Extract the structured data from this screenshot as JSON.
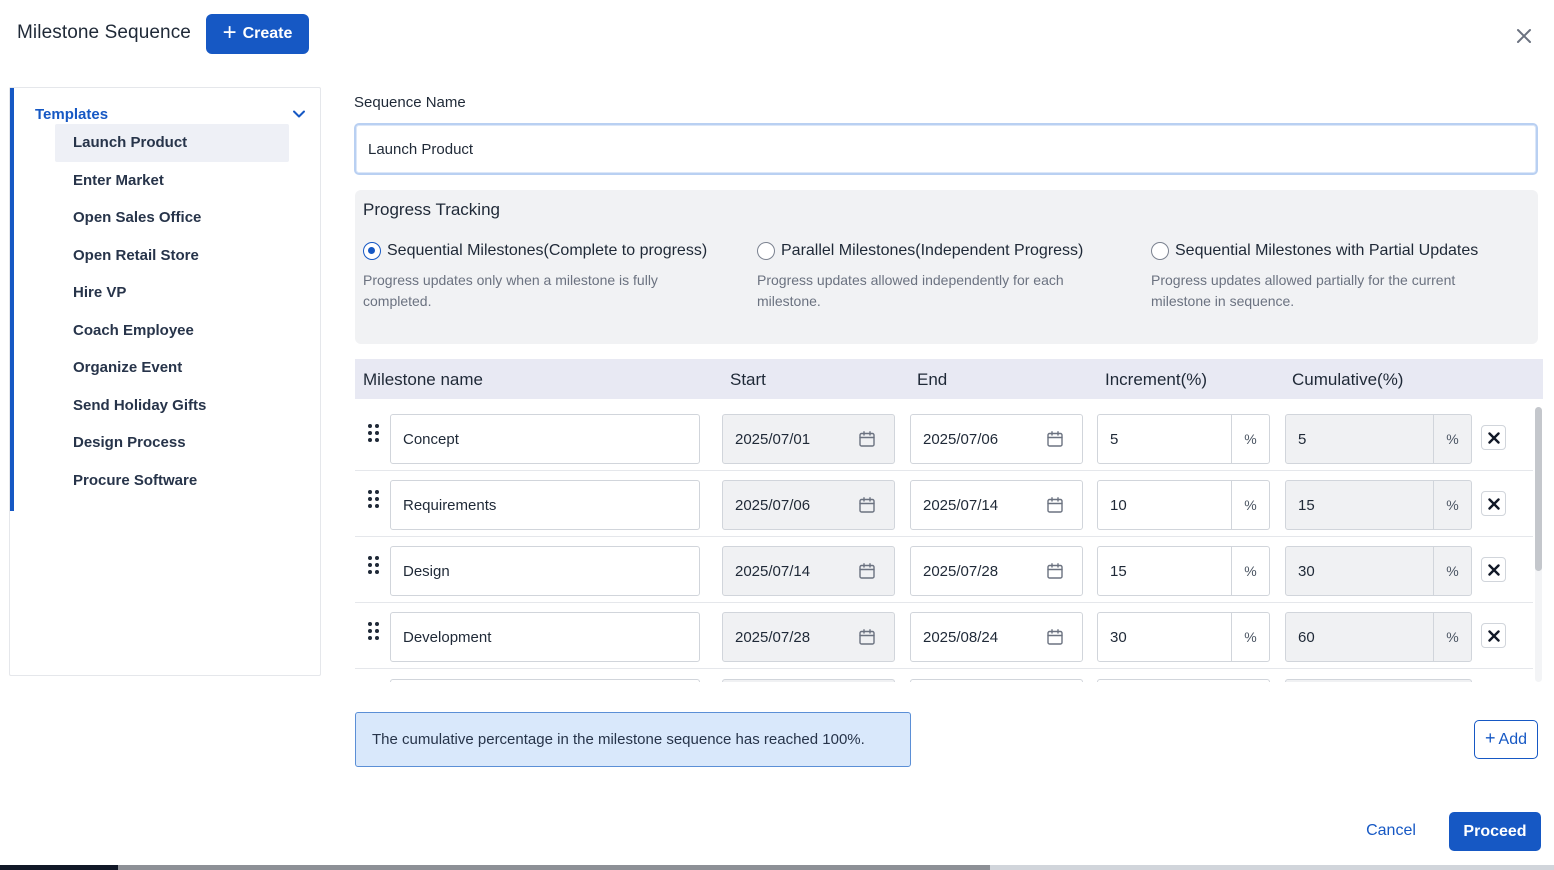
{
  "header": {
    "title": "Milestone Sequence",
    "create_label": "Create",
    "close_icon": "close-icon"
  },
  "sidebar": {
    "section_label": "Templates",
    "items": [
      {
        "label": "Launch Product",
        "active": true
      },
      {
        "label": "Enter Market"
      },
      {
        "label": "Open Sales Office"
      },
      {
        "label": "Open Retail Store"
      },
      {
        "label": "Hire VP"
      },
      {
        "label": "Coach Employee"
      },
      {
        "label": "Organize Event"
      },
      {
        "label": "Send Holiday Gifts"
      },
      {
        "label": "Design Process"
      },
      {
        "label": "Procure Software"
      }
    ]
  },
  "sequence": {
    "label": "Sequence Name",
    "value": "Launch Product"
  },
  "progress": {
    "title": "Progress Tracking",
    "options": [
      {
        "label": "Sequential Milestones(Complete to progress)",
        "desc": "Progress updates only when a milestone is fully completed.",
        "selected": true
      },
      {
        "label": "Parallel Milestones(Independent Progress)",
        "desc": "Progress updates allowed independently for each milestone.",
        "selected": false
      },
      {
        "label": "Sequential Milestones with Partial Updates",
        "desc": "Progress updates allowed partially for the current milestone in sequence.",
        "selected": false
      }
    ]
  },
  "table": {
    "columns": {
      "name": "Milestone name",
      "start": "Start",
      "end": "End",
      "increment": "Increment(%)",
      "cumulative": "Cumulative(%)"
    },
    "percent_suffix": "%",
    "rows": [
      {
        "name": "Concept",
        "start": "2025/07/01",
        "end": "2025/07/06",
        "increment": "5",
        "cumulative": "5"
      },
      {
        "name": "Requirements",
        "start": "2025/07/06",
        "end": "2025/07/14",
        "increment": "10",
        "cumulative": "15"
      },
      {
        "name": "Design",
        "start": "2025/07/14",
        "end": "2025/07/28",
        "increment": "15",
        "cumulative": "30"
      },
      {
        "name": "Development",
        "start": "2025/07/28",
        "end": "2025/08/24",
        "increment": "30",
        "cumulative": "60"
      }
    ]
  },
  "info": {
    "message": "The cumulative percentage in the milestone sequence has reached 100%."
  },
  "actions": {
    "add_label": "Add",
    "cancel_label": "Cancel",
    "proceed_label": "Proceed"
  },
  "colors": {
    "primary": "#1658c4",
    "info_bg": "#d9e8fb",
    "table_header_bg": "#e8e9f3"
  }
}
